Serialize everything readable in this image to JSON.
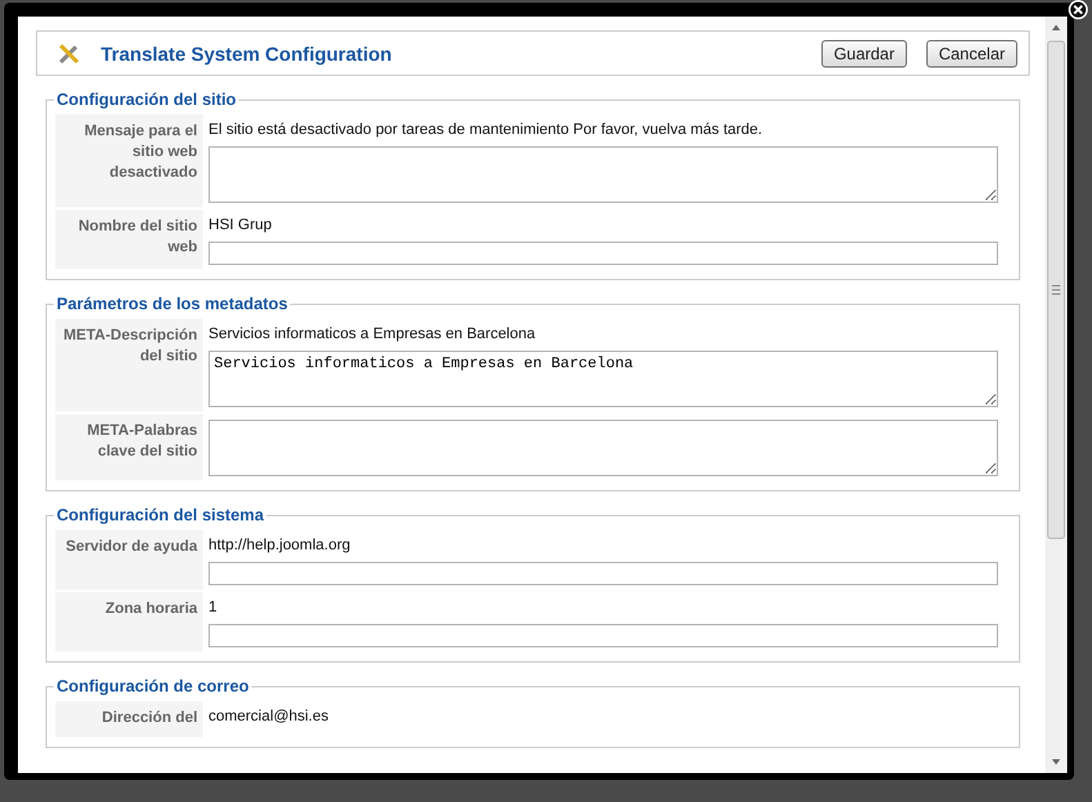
{
  "header": {
    "title": "Translate System Configuration",
    "buttons": [
      "Guardar",
      "Cancelar"
    ]
  },
  "sections": [
    {
      "legend": "Configuración del sitio",
      "rows": [
        {
          "label": "Mensaje para el sitio web desactivado",
          "current": "El sitio está desactivado por tareas de mantenimiento Por favor, vuelva más tarde.",
          "field": {
            "kind": "textarea"
          }
        },
        {
          "label": "Nombre del sitio web",
          "current": "HSI Grup",
          "field": {
            "kind": "input"
          }
        }
      ]
    },
    {
      "legend": "Parámetros de los metadatos",
      "rows": [
        {
          "label": "META-Descripción del sitio",
          "current": "Servicios informaticos a Empresas en Barcelona",
          "field": {
            "kind": "textarea",
            "value": "Servicios informaticos a Empresas en Barcelona"
          }
        },
        {
          "label": "META-Palabras clave del sitio",
          "field": {
            "kind": "textarea"
          }
        }
      ]
    },
    {
      "legend": "Configuración del sistema",
      "rows": [
        {
          "label": "Servidor de ayuda",
          "current": "http://help.joomla.org",
          "field": {
            "kind": "input"
          }
        },
        {
          "label": "Zona horaria",
          "current": "1",
          "field": {
            "kind": "input"
          }
        }
      ]
    },
    {
      "legend": "Configuración de correo",
      "rows": [
        {
          "label": "Dirección del",
          "current": "comercial@hsi.es"
        }
      ]
    }
  ]
}
